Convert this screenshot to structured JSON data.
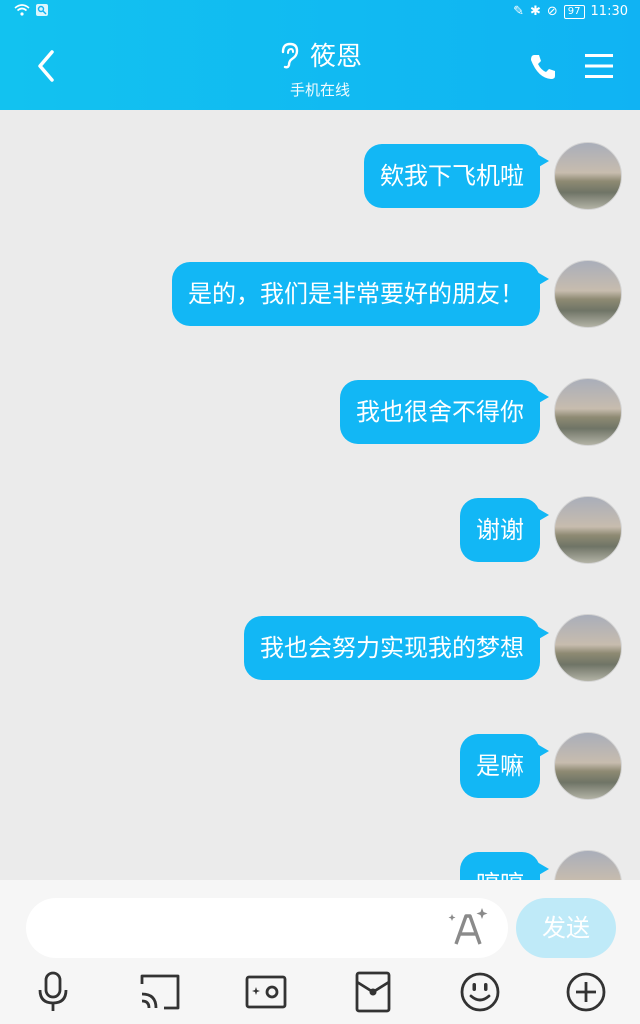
{
  "status": {
    "battery": "97",
    "time": "11:30"
  },
  "header": {
    "title": "筱恩",
    "subtitle": "手机在线"
  },
  "messages": [
    {
      "text": "欸我下飞机啦"
    },
    {
      "text": "是的，我们是非常要好的朋友！"
    },
    {
      "text": "我也很舍不得你"
    },
    {
      "text": "谢谢"
    },
    {
      "text": "我也会努力实现我的梦想"
    },
    {
      "text": "是嘛"
    },
    {
      "text": "哼哼"
    }
  ],
  "input": {
    "placeholder": "",
    "send_label": "发送"
  },
  "colors": {
    "accent": "#12b7f5",
    "header": "#10b3f3",
    "background": "#ebebeb"
  },
  "toolbar_icons": [
    "microphone-icon",
    "screen-cast-icon",
    "photo-icon",
    "red-packet-icon",
    "emoji-icon",
    "plus-icon"
  ]
}
